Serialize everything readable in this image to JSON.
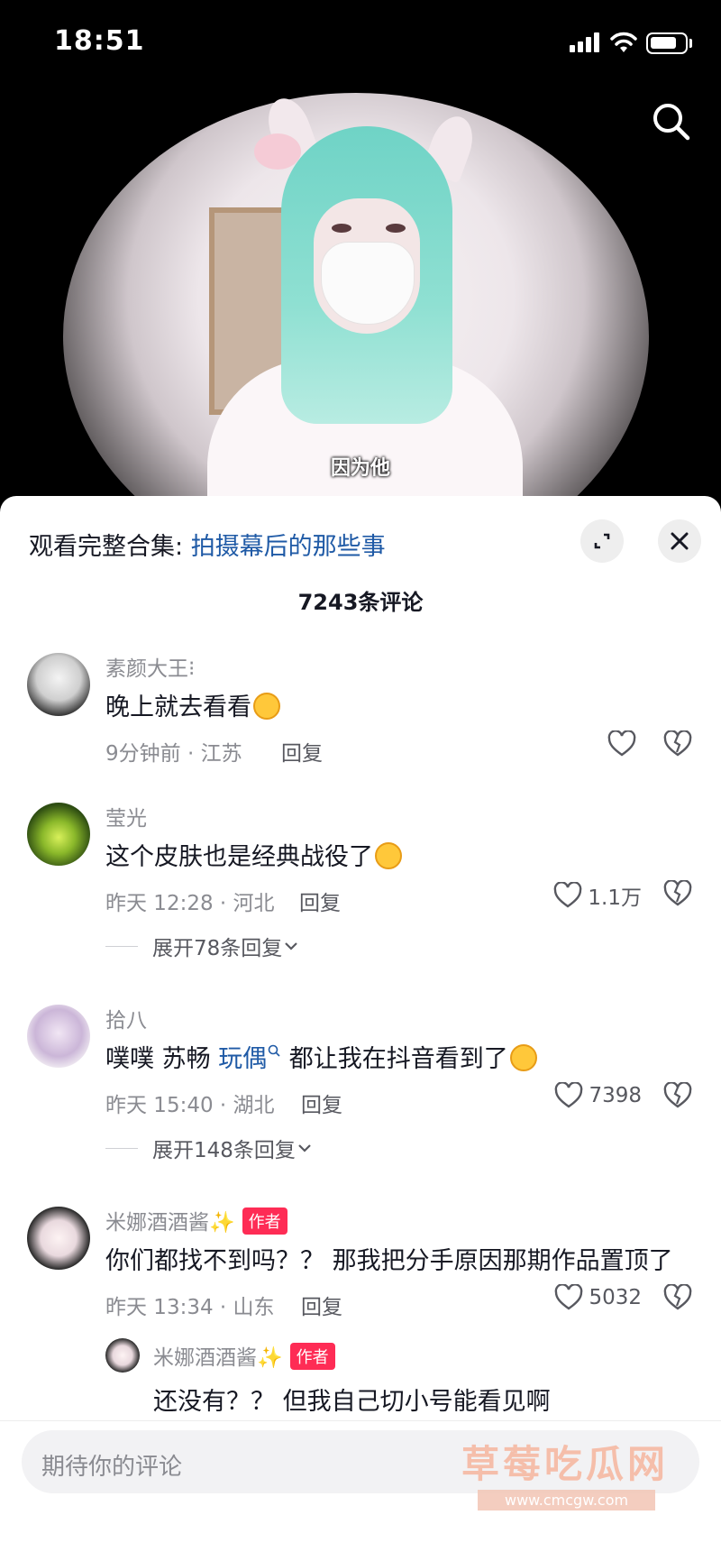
{
  "status_bar": {
    "time": "18:51"
  },
  "video": {
    "subtitle": "因为他"
  },
  "sheet": {
    "collection_prefix": "观看完整合集: ",
    "collection_title": "拍摄幕后的那些事",
    "comment_count": "7243条评论"
  },
  "comments": [
    {
      "user": "素颜大王⁝",
      "text": "晚上就去看看",
      "time_loc": "9分钟前 · 江苏",
      "reply": "回复",
      "likes": ""
    },
    {
      "user": "莹光",
      "text": "这个皮肤也是经典战役了",
      "time_loc": "昨天 12:28 · 河北",
      "reply": "回复",
      "likes": "1.1万",
      "expand": "展开78条回复"
    },
    {
      "user": "拾八",
      "text_a": "噗噗 苏畅 ",
      "keyword": "玩偶",
      "text_b": " 都让我在抖音看到了",
      "time_loc": "昨天 15:40 · 湖北",
      "reply": "回复",
      "likes": "7398",
      "expand": "展开148条回复"
    },
    {
      "user": "米娜酒酒酱✨",
      "tag": "作者",
      "text": "你们都找不到吗？？ 那我把分手原因那期作品置顶了",
      "time_loc": "昨天 13:34 · 山东",
      "reply": "回复",
      "likes": "5032"
    }
  ],
  "sub_reply": {
    "user": "米娜酒酒酱✨",
    "tag": "作者",
    "text": "还没有？？ 但我自己切小号能看见啊"
  },
  "input": {
    "placeholder": "期待你的评论"
  },
  "watermark": {
    "text": "草莓吃瓜网",
    "url": "www.cmcgw.com"
  },
  "colors": {
    "accent_red": "#fe2c55",
    "link_blue": "#1f5aa6",
    "muted": "#8a8b91"
  }
}
